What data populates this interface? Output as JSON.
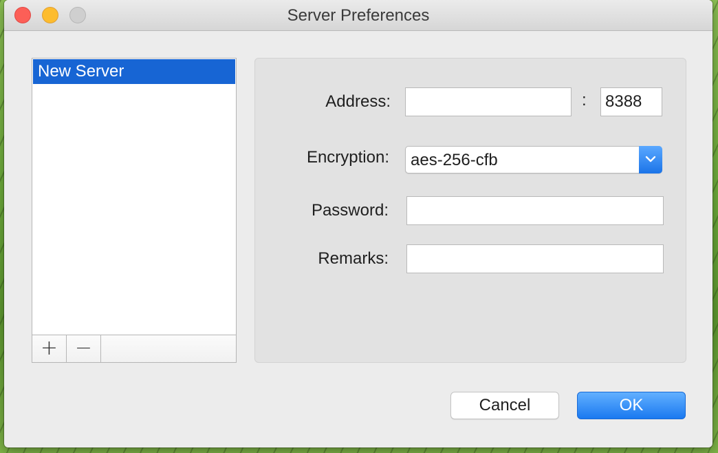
{
  "window": {
    "title": "Server Preferences"
  },
  "server_list": {
    "items": [
      {
        "label": "New Server",
        "selected": true
      }
    ],
    "add_label": "+",
    "remove_label": "−"
  },
  "form": {
    "address": {
      "label": "Address:",
      "value": "",
      "separator": ":",
      "port": "8388"
    },
    "encryption": {
      "label": "Encryption:",
      "value": "aes-256-cfb"
    },
    "password": {
      "label": "Password:",
      "value": ""
    },
    "remarks": {
      "label": "Remarks:",
      "value": ""
    }
  },
  "buttons": {
    "cancel": "Cancel",
    "ok": "OK"
  },
  "icons": {
    "close": "close-icon",
    "minimize": "minimize-icon",
    "zoom": "zoom-icon",
    "dropdown": "chevron-down-icon"
  },
  "colors": {
    "selection": "#1765d4",
    "accent": "#1a79f0"
  }
}
